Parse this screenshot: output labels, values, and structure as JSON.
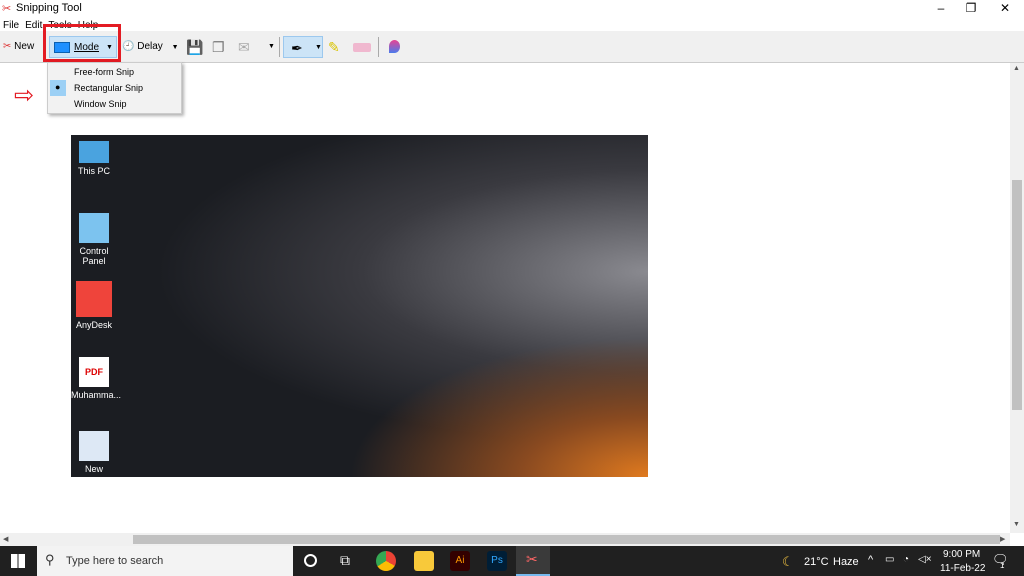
{
  "window": {
    "title": "Snipping Tool",
    "minimize": "–",
    "restore": "❐",
    "close": "✕"
  },
  "menu": [
    "File",
    "Edit",
    "Tools",
    "Help"
  ],
  "toolbar": {
    "new_label": "New",
    "mode_label": "Mode",
    "delay_label": "Delay",
    "active_tool": "pen"
  },
  "mode_menu": {
    "items": [
      "Free-form Snip",
      "Rectangular Snip",
      "Window Snip"
    ],
    "selected": "Rectangular Snip"
  },
  "desktop_icons": [
    "This PC",
    "Control Panel",
    "AnyDesk",
    "Muhamma...",
    "New"
  ],
  "taskbar": {
    "search_placeholder": "Type here to search",
    "apps": [
      "chrome",
      "file-explorer",
      "illustrator",
      "photoshop",
      "snipping-tool"
    ],
    "ai": "Ai",
    "ps": "Ps",
    "temperature": "21°C",
    "weather": "Haze",
    "time": "9:00 PM",
    "date": "11-Feb-22",
    "notification_count": "1"
  },
  "colors": {
    "highlight": "#e31b23",
    "accent": "#0078d7",
    "taskbar": "#202020"
  }
}
